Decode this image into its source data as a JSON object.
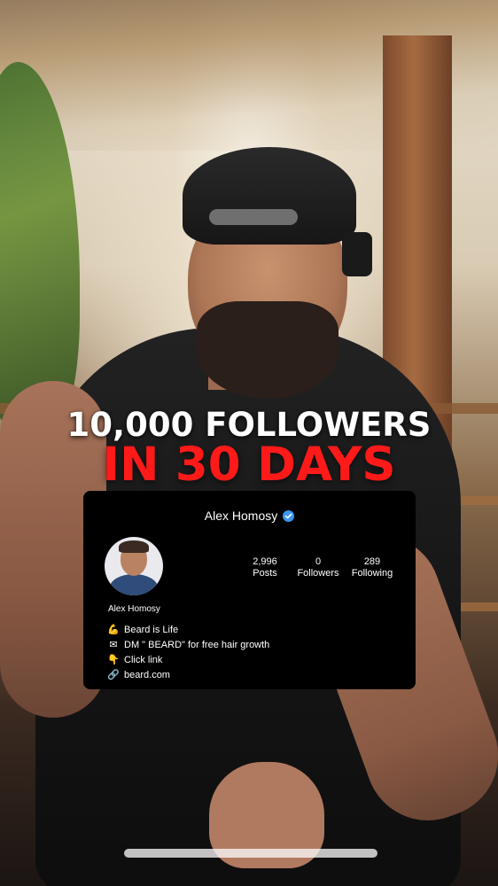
{
  "headline": {
    "line1": "10,000 FOLLOWERS",
    "line2": "IN 30 DAYS",
    "line1_color": "#ffffff",
    "line2_color": "#ff1a1a"
  },
  "profile_card": {
    "username": "Alex Homosy",
    "verified": true,
    "verified_color": "#3897f0",
    "display_name": "Alex Homosy",
    "stats": [
      {
        "value": "2,996",
        "label": "Posts"
      },
      {
        "value": "0",
        "label": "Followers"
      },
      {
        "value": "289",
        "label": "Following"
      }
    ],
    "bio": [
      {
        "icon": "flexed-biceps-icon",
        "glyph": "💪",
        "text": "Beard is Life"
      },
      {
        "icon": "envelope-icon",
        "glyph": "✉",
        "text": "DM \" BEARD\" for free hair growth"
      },
      {
        "icon": "pointing-down-icon",
        "glyph": "👇",
        "text": "Click link"
      },
      {
        "icon": "link-icon",
        "glyph": "🔗",
        "text": "beard.com"
      }
    ]
  }
}
